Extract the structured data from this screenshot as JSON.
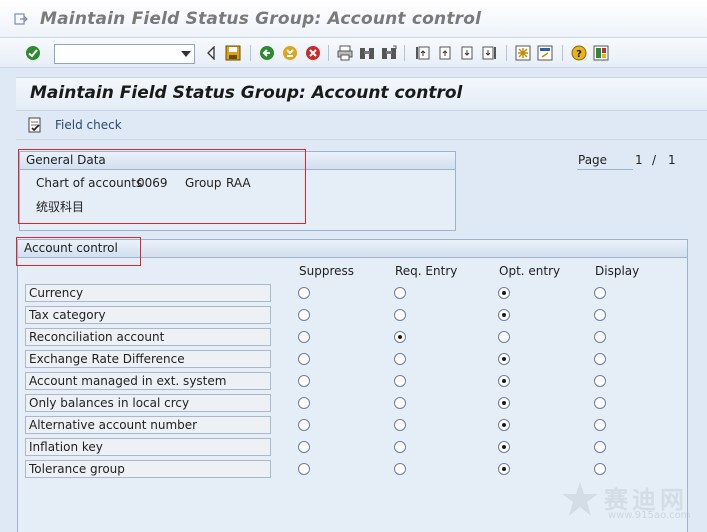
{
  "window": {
    "title": "Maintain Field Status Group: Account control"
  },
  "toolbar": {
    "command_field_value": "",
    "icons": [
      "enter-icon",
      "back-icon",
      "save-icon",
      "back-green-icon",
      "exit-icon",
      "cancel-icon",
      "print-icon",
      "find-icon",
      "find-next-icon",
      "first-page-icon",
      "previous-page-icon",
      "next-page-icon",
      "last-page-icon",
      "create-session-icon",
      "shortcut-icon",
      "help-icon",
      "layout-icon"
    ]
  },
  "screen": {
    "header": "Maintain Field Status Group: Account control",
    "field_check_label": "Field check"
  },
  "general_data": {
    "title": "General Data",
    "chart_label": "Chart of accounts",
    "chart_value": "0069",
    "group_label": "Group",
    "group_value": "RAA",
    "group_description": "统驭科目"
  },
  "pagination": {
    "label": "Page",
    "current": "1",
    "separator": "/",
    "total": "1"
  },
  "account_control": {
    "title": "Account control",
    "columns": [
      "Suppress",
      "Req. Entry",
      "Opt. entry",
      "Display"
    ],
    "rows": [
      {
        "label": "Currency",
        "selected": 2
      },
      {
        "label": "Tax category",
        "selected": 2
      },
      {
        "label": "Reconciliation account",
        "selected": 1
      },
      {
        "label": "Exchange Rate Difference",
        "selected": 2
      },
      {
        "label": "Account managed in ext. system",
        "selected": 2
      },
      {
        "label": "Only balances in local crcy",
        "selected": 2
      },
      {
        "label": "Alternative account number",
        "selected": 2
      },
      {
        "label": "Inflation key",
        "selected": 2
      },
      {
        "label": "Tolerance group",
        "selected": 2
      }
    ]
  },
  "watermark": {
    "text": "赛迪网",
    "url": "www.915ao.com"
  }
}
